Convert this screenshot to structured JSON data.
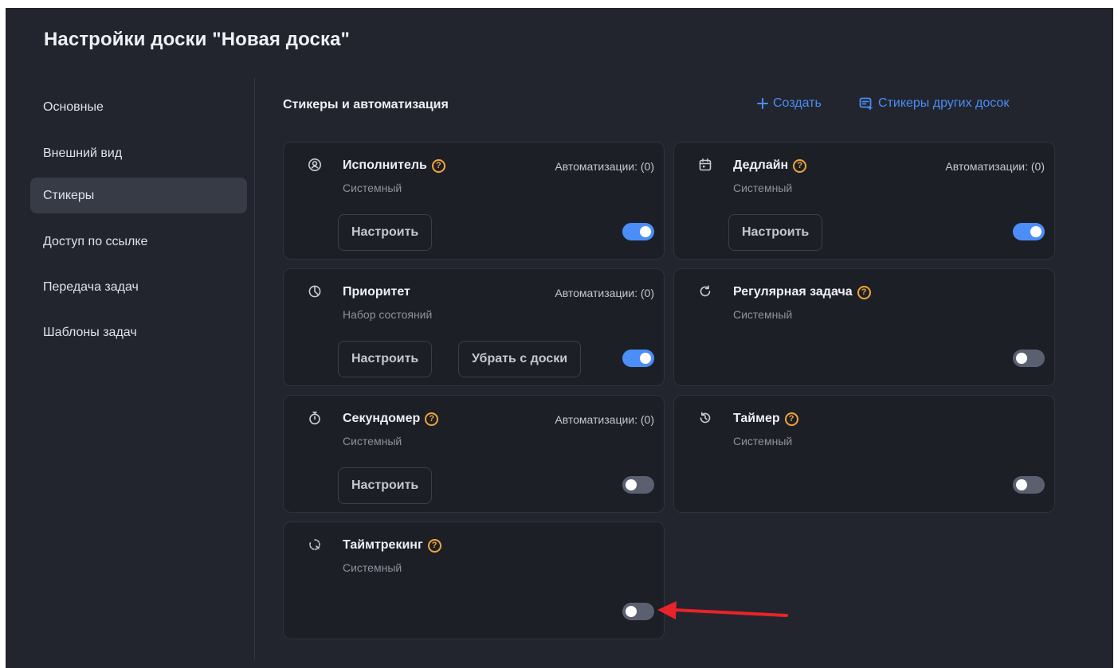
{
  "title": "Настройки доски \"Новая доска\"",
  "sidebar": {
    "items": [
      {
        "label": "Основные",
        "active": false
      },
      {
        "label": "Внешний вид",
        "active": false
      },
      {
        "label": "Стикеры",
        "active": true
      },
      {
        "label": "Доступ по ссылке",
        "active": false
      },
      {
        "label": "Передача задач",
        "active": false
      },
      {
        "label": "Шаблоны задач",
        "active": false
      }
    ]
  },
  "main": {
    "section_title": "Стикеры и автоматизация",
    "create_label": "Создать",
    "create_icon": "plus-icon",
    "other_boards_label": "Стикеры других досок",
    "other_boards_icon": "sticker-import-icon",
    "cards": [
      {
        "name": "Исполнитель",
        "icon": "user-circle-icon",
        "help": "?",
        "subtitle": "Системный",
        "automations": "Автоматизации: (0)",
        "configure": "Настроить",
        "enabled": true
      },
      {
        "name": "Дедлайн",
        "icon": "calendar-icon",
        "help": "?",
        "subtitle": "Системный",
        "automations": "Автоматизации: (0)",
        "configure": "Настроить",
        "enabled": true
      },
      {
        "name": "Приоритет",
        "icon": "priority-pie-icon",
        "subtitle": "Набор состояний",
        "automations": "Автоматизации: (0)",
        "configure": "Настроить",
        "remove": "Убрать с доски",
        "enabled": true
      },
      {
        "name": "Регулярная задача",
        "icon": "repeat-icon",
        "help": "?",
        "subtitle": "Системный",
        "enabled": false
      },
      {
        "name": "Секундомер",
        "icon": "stopwatch-icon",
        "help": "?",
        "subtitle": "Системный",
        "automations": "Автоматизации: (0)",
        "configure": "Настроить",
        "enabled": false
      },
      {
        "name": "Таймер",
        "icon": "timer-history-icon",
        "help": "?",
        "subtitle": "Системный",
        "enabled": false
      },
      {
        "name": "Таймтрекинг",
        "icon": "timetracking-icon",
        "help": "?",
        "subtitle": "Системный",
        "enabled": false
      }
    ]
  },
  "colors": {
    "background": "#22252e",
    "card": "#1c1f26",
    "accent": "#4c8ef7",
    "help": "#f0a53a",
    "annotation_arrow": "#e8232a"
  }
}
